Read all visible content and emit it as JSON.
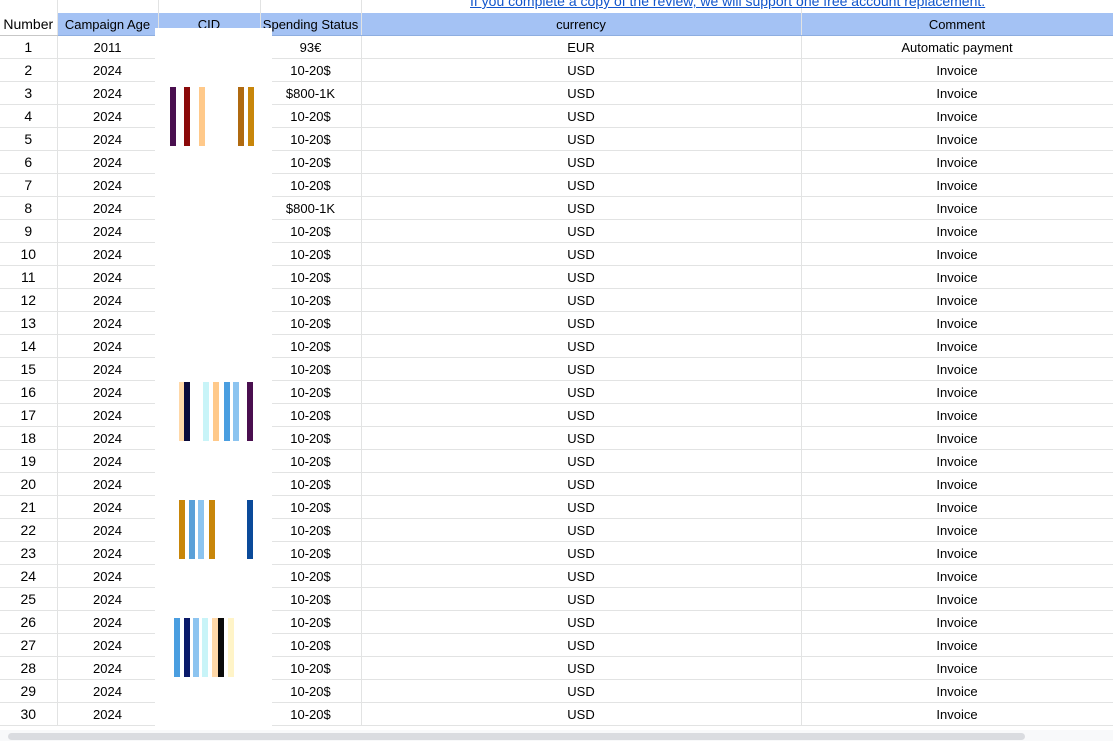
{
  "banner": {
    "link_text": "If you complete a copy of the review, we will support one free account replacement."
  },
  "columns": {
    "number": "Number",
    "campaign_age": "Campaign Age",
    "cid": "CID",
    "spending_status": "Spending Status",
    "currency": "currency",
    "comment": "Comment"
  },
  "rows": [
    {
      "number": "1",
      "campaign_age": "2011",
      "spending_status": "93€",
      "currency": "EUR",
      "comment": "Automatic payment"
    },
    {
      "number": "2",
      "campaign_age": "2024",
      "spending_status": "10-20$",
      "currency": "USD",
      "comment": "Invoice"
    },
    {
      "number": "3",
      "campaign_age": "2024",
      "spending_status": "$800-1K",
      "currency": "USD",
      "comment": "Invoice"
    },
    {
      "number": "4",
      "campaign_age": "2024",
      "spending_status": "10-20$",
      "currency": "USD",
      "comment": "Invoice"
    },
    {
      "number": "5",
      "campaign_age": "2024",
      "spending_status": "10-20$",
      "currency": "USD",
      "comment": "Invoice"
    },
    {
      "number": "6",
      "campaign_age": "2024",
      "spending_status": "10-20$",
      "currency": "USD",
      "comment": "Invoice"
    },
    {
      "number": "7",
      "campaign_age": "2024",
      "spending_status": "10-20$",
      "currency": "USD",
      "comment": "Invoice"
    },
    {
      "number": "8",
      "campaign_age": "2024",
      "spending_status": "$800-1K",
      "currency": "USD",
      "comment": "Invoice"
    },
    {
      "number": "9",
      "campaign_age": "2024",
      "spending_status": "10-20$",
      "currency": "USD",
      "comment": "Invoice"
    },
    {
      "number": "10",
      "campaign_age": "2024",
      "spending_status": "10-20$",
      "currency": "USD",
      "comment": "Invoice"
    },
    {
      "number": "11",
      "campaign_age": "2024",
      "spending_status": "10-20$",
      "currency": "USD",
      "comment": "Invoice"
    },
    {
      "number": "12",
      "campaign_age": "2024",
      "spending_status": "10-20$",
      "currency": "USD",
      "comment": "Invoice"
    },
    {
      "number": "13",
      "campaign_age": "2024",
      "spending_status": "10-20$",
      "currency": "USD",
      "comment": "Invoice"
    },
    {
      "number": "14",
      "campaign_age": "2024",
      "spending_status": "10-20$",
      "currency": "USD",
      "comment": "Invoice"
    },
    {
      "number": "15",
      "campaign_age": "2024",
      "spending_status": "10-20$",
      "currency": "USD",
      "comment": "Invoice"
    },
    {
      "number": "16",
      "campaign_age": "2024",
      "spending_status": "10-20$",
      "currency": "USD",
      "comment": "Invoice"
    },
    {
      "number": "17",
      "campaign_age": "2024",
      "spending_status": "10-20$",
      "currency": "USD",
      "comment": "Invoice"
    },
    {
      "number": "18",
      "campaign_age": "2024",
      "spending_status": "10-20$",
      "currency": "USD",
      "comment": "Invoice"
    },
    {
      "number": "19",
      "campaign_age": "2024",
      "spending_status": "10-20$",
      "currency": "USD",
      "comment": "Invoice"
    },
    {
      "number": "20",
      "campaign_age": "2024",
      "spending_status": "10-20$",
      "currency": "USD",
      "comment": "Invoice"
    },
    {
      "number": "21",
      "campaign_age": "2024",
      "spending_status": "10-20$",
      "currency": "USD",
      "comment": "Invoice"
    },
    {
      "number": "22",
      "campaign_age": "2024",
      "spending_status": "10-20$",
      "currency": "USD",
      "comment": "Invoice"
    },
    {
      "number": "23",
      "campaign_age": "2024",
      "spending_status": "10-20$",
      "currency": "USD",
      "comment": "Invoice"
    },
    {
      "number": "24",
      "campaign_age": "2024",
      "spending_status": "10-20$",
      "currency": "USD",
      "comment": "Invoice"
    },
    {
      "number": "25",
      "campaign_age": "2024",
      "spending_status": "10-20$",
      "currency": "USD",
      "comment": "Invoice"
    },
    {
      "number": "26",
      "campaign_age": "2024",
      "spending_status": "10-20$",
      "currency": "USD",
      "comment": "Invoice"
    },
    {
      "number": "27",
      "campaign_age": "2024",
      "spending_status": "10-20$",
      "currency": "USD",
      "comment": "Invoice"
    },
    {
      "number": "28",
      "campaign_age": "2024",
      "spending_status": "10-20$",
      "currency": "USD",
      "comment": "Invoice"
    },
    {
      "number": "29",
      "campaign_age": "2024",
      "spending_status": "10-20$",
      "currency": "USD",
      "comment": "Invoice"
    },
    {
      "number": "30",
      "campaign_age": "2024",
      "spending_status": "10-20$",
      "currency": "USD",
      "comment": "Invoice"
    }
  ],
  "redaction_barcodes": [
    {
      "colors": [
        "#4a0f4f",
        "#8b0a0a",
        "#ffc98a",
        "#b06a10",
        "#c8860a"
      ]
    },
    {
      "colors": [
        "#ffd8a8",
        "#0a0a3a",
        "#c8f4f8",
        "#ffc98a",
        "#4a9ee0",
        "#8cc4f0",
        "#4a0f4f"
      ]
    },
    {
      "colors": [
        "#c8860a",
        "#5aa0d8",
        "#8cc4f0",
        "#c8860a",
        "#0a4a9a"
      ]
    },
    {
      "colors": [
        "#4a9ee0",
        "#0a1a6a",
        "#8cc4f0",
        "#c8f4f8",
        "#ffd8a8",
        "#0a0a0a",
        "#fff4c8"
      ]
    }
  ],
  "colors": {
    "header_bg": "#a4c2f4",
    "link": "#1155cc",
    "gridline": "#e2e3e3"
  }
}
